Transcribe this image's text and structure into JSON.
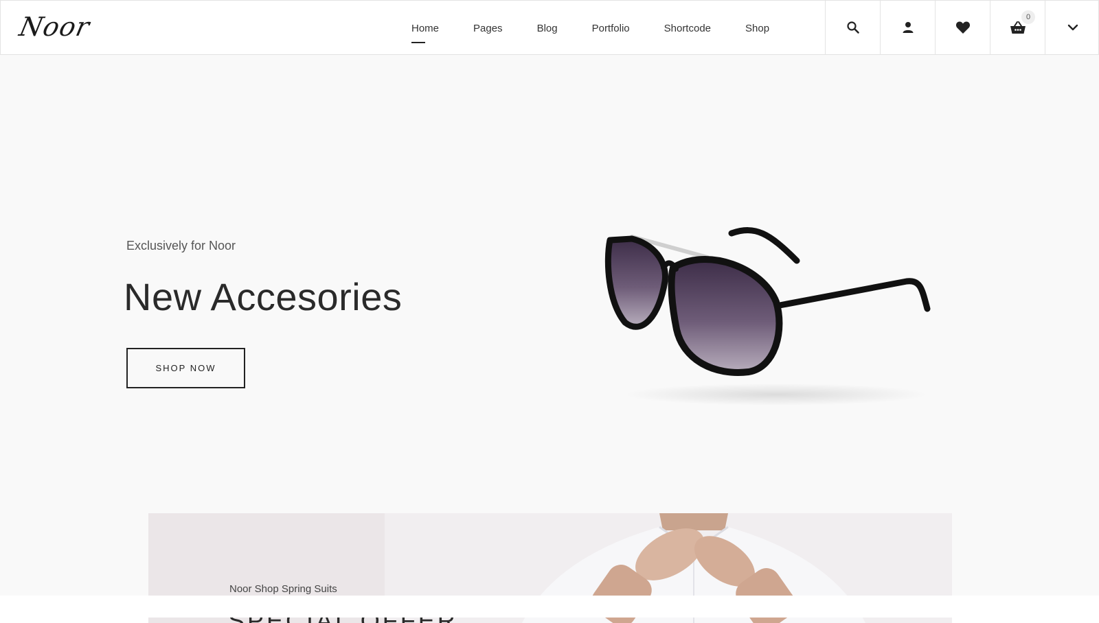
{
  "brand": {
    "logo_text": "Noor"
  },
  "nav": {
    "items": [
      {
        "label": "Home",
        "active": true
      },
      {
        "label": "Pages",
        "active": false
      },
      {
        "label": "Blog",
        "active": false
      },
      {
        "label": "Portfolio",
        "active": false
      },
      {
        "label": "Shortcode",
        "active": false
      },
      {
        "label": "Shop",
        "active": false
      }
    ]
  },
  "header_icons": {
    "search": "search-icon",
    "account": "user-icon",
    "wishlist": "heart-icon",
    "cart": "basket-icon",
    "cart_count": "0",
    "more": "chevron-down-icon"
  },
  "hero": {
    "subtitle": "Exclusively for Noor",
    "title": "New Accesories",
    "button_label": "SHOP NOW",
    "image": "sunglasses-product-image"
  },
  "offer": {
    "subtitle": "Noor Shop Spring Suits",
    "title": "SPECIAL OFFER",
    "image": "man-buttoning-white-shirt"
  },
  "colors": {
    "hero_bg": "#f9f9f9",
    "text_dark": "#2a2a2a",
    "offer_bg": "#ebe6e8",
    "lens": "#5c4a66"
  }
}
